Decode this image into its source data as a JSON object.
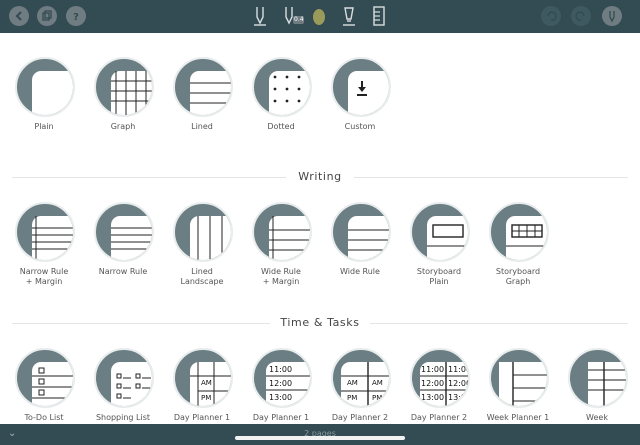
{
  "toolbar": {
    "left_icons": [
      "back-icon",
      "pages-icon",
      "help-icon"
    ],
    "tools": [
      "pen-icon",
      "pen-badge-icon",
      "eraser-icon",
      "highlighter-icon",
      "ruler-icon"
    ],
    "tool_badge": "0.4",
    "right_icons": [
      "undo-icon",
      "redo-icon",
      "pen-settings-icon"
    ]
  },
  "sections": {
    "writing": "Writing",
    "time_tasks": "Time & Tasks"
  },
  "templates": {
    "basic": [
      "Plain",
      "Graph",
      "Lined",
      "Dotted",
      "Custom"
    ],
    "writing": [
      "Narrow Rule\n+ Margin",
      "Narrow Rule",
      "Lined\nLandscape",
      "Wide Rule\n+ Margin",
      "Wide Rule",
      "Storyboard\nPlain",
      "Storyboard\nGraph"
    ],
    "time": [
      "To-Do List",
      "Shopping List",
      "Day Planner 1",
      "Day Planner 1",
      "Day Planner 2",
      "Day Planner 2",
      "Week Planner 1",
      "Week"
    ]
  },
  "planner_labels": {
    "am": "AM",
    "pm": "PM",
    "t1": "11:00",
    "t2": "12:00",
    "t3": "13:00"
  },
  "bottom": {
    "pages": "2 pages",
    "chevron": "⌄"
  },
  "colors": {
    "toolbar": "#334b52",
    "circle": "#6b7e84"
  }
}
